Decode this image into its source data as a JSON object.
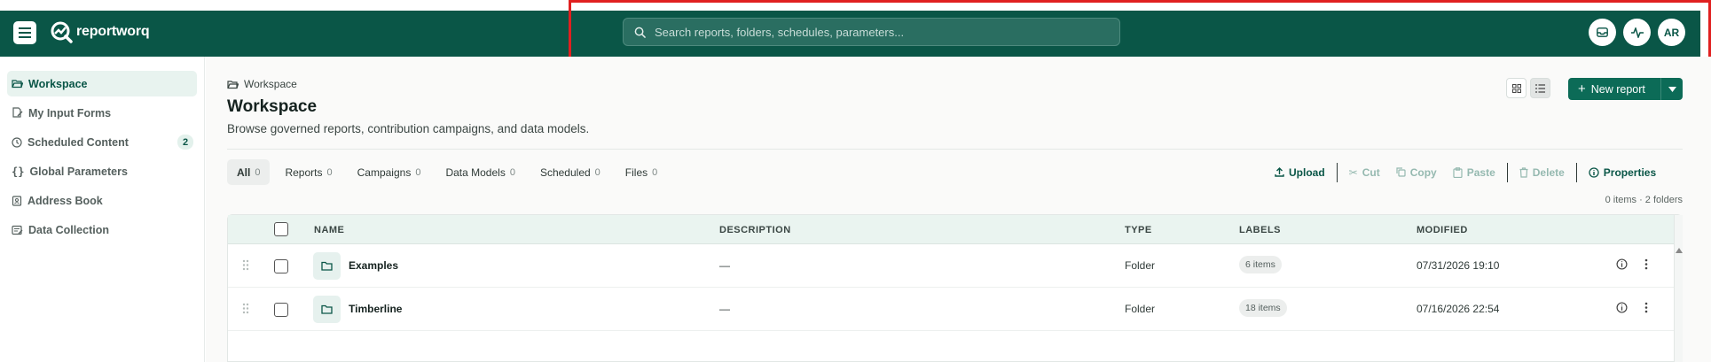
{
  "app": {
    "name": "reportworq",
    "colors": {
      "brand": "#0a5647",
      "accent": "#0c6b57",
      "highlight": "#e02020"
    }
  },
  "search": {
    "placeholder": "Search reports, folders, schedules, parameters..."
  },
  "user": {
    "initials": "AR"
  },
  "sidebar": {
    "items": [
      {
        "label": "Workspace",
        "icon": "folder-open-icon",
        "active": true
      },
      {
        "label": "My Input Forms",
        "icon": "form-edit-icon"
      },
      {
        "label": "Scheduled Content",
        "icon": "clock-icon",
        "badge": "2"
      },
      {
        "label": "Global Parameters",
        "icon": "braces-icon"
      },
      {
        "label": "Address Book",
        "icon": "contact-book-icon"
      },
      {
        "label": "Data Collection",
        "icon": "data-collection-icon"
      }
    ]
  },
  "main": {
    "breadcrumb": "Workspace",
    "title": "Workspace",
    "subtitle": "Browse governed reports, contribution campaigns, and data models.",
    "new_report_label": "New report",
    "tabs": [
      {
        "label": "All",
        "count": "0"
      },
      {
        "label": "Reports",
        "count": "0"
      },
      {
        "label": "Campaigns",
        "count": "0"
      },
      {
        "label": "Data Models",
        "count": "0"
      },
      {
        "label": "Scheduled",
        "count": "0"
      },
      {
        "label": "Files",
        "count": "0"
      }
    ],
    "toolbar": {
      "upload": "Upload",
      "cut": "Cut",
      "copy": "Copy",
      "paste": "Paste",
      "delete": "Delete",
      "properties": "Properties"
    },
    "summary": "0 items · 2 folders",
    "table": {
      "columns": {
        "name": "NAME",
        "description": "DESCRIPTION",
        "type": "TYPE",
        "labels": "LABELS",
        "modified": "MODIFIED"
      },
      "rows": [
        {
          "name": "Examples",
          "description": "—",
          "type": "Folder",
          "labels": "6 items",
          "modified": "07/31/2026 19:10"
        },
        {
          "name": "Timberline",
          "description": "—",
          "type": "Folder",
          "labels": "18 items",
          "modified": "07/16/2026 22:54"
        }
      ]
    }
  }
}
